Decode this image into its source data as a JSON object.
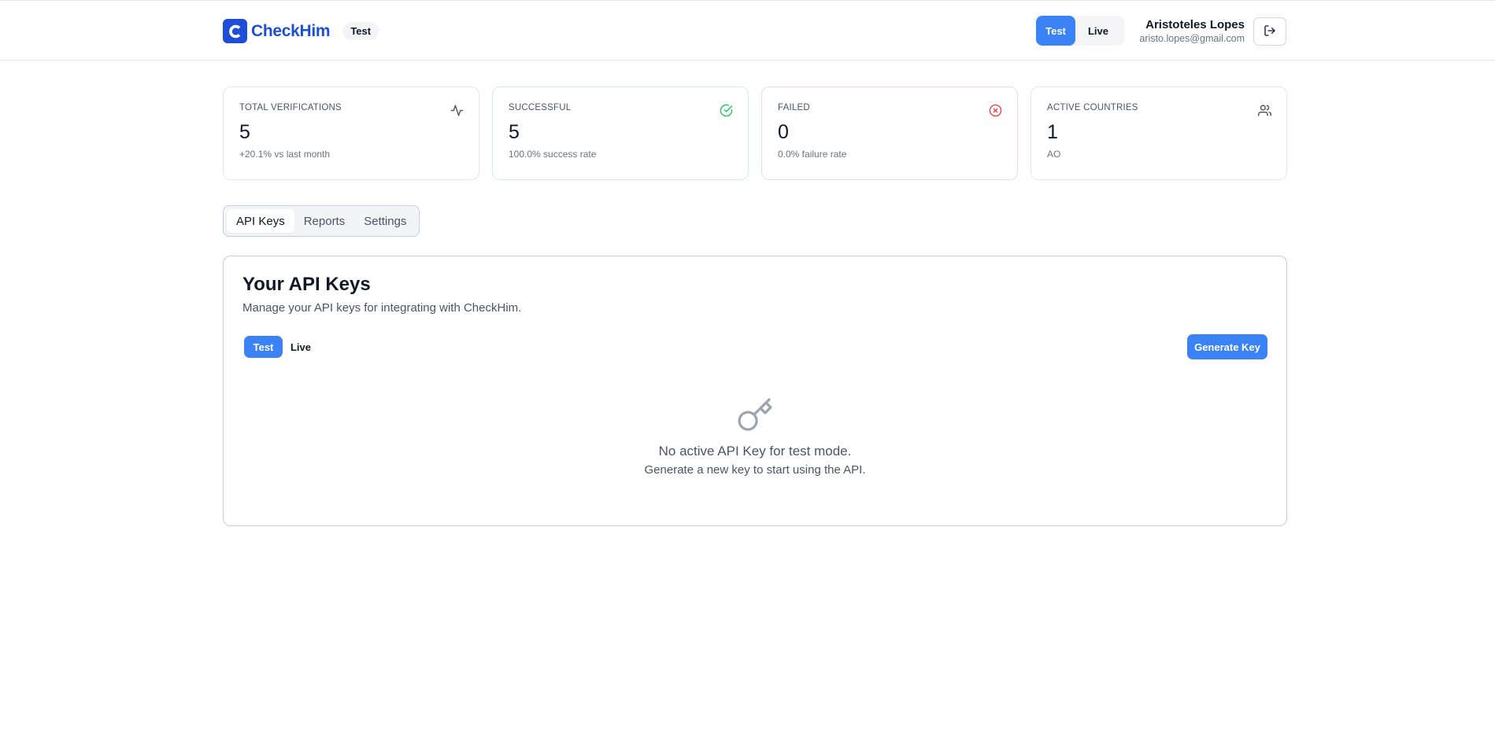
{
  "header": {
    "brand": "CheckHim",
    "env_badge": "Test",
    "mode_test": "Test",
    "mode_live": "Live",
    "user_name": "Aristoteles Lopes",
    "user_email": "aristo.lopes@gmail.com",
    "logout_icon": "logout-icon"
  },
  "stats": [
    {
      "label": "TOTAL VERIFICATIONS",
      "value": "5",
      "sub": "+20.1% vs last month",
      "icon": "activity-icon"
    },
    {
      "label": "SUCCESSFUL",
      "value": "5",
      "sub": "100.0% success rate",
      "icon": "check-circle-icon"
    },
    {
      "label": "FAILED",
      "value": "0",
      "sub": "0.0% failure rate",
      "icon": "x-circle-icon"
    },
    {
      "label": "ACTIVE COUNTRIES",
      "value": "1",
      "sub": "AO",
      "icon": "users-icon"
    }
  ],
  "tabs": [
    "API Keys",
    "Reports",
    "Settings"
  ],
  "panel": {
    "title": "Your API Keys",
    "description": "Manage your API keys for integrating with CheckHim.",
    "toggle_test": "Test",
    "toggle_live": "Live",
    "generate_label": "Generate Key",
    "empty_icon": "key-icon",
    "empty_title": "No active API Key for test mode.",
    "empty_sub": "Generate a new key to start using the API."
  },
  "colors": {
    "brand": "#1d4ed8",
    "primary": "#3b82f6",
    "success": "#22c55e",
    "danger": "#ef4444"
  }
}
